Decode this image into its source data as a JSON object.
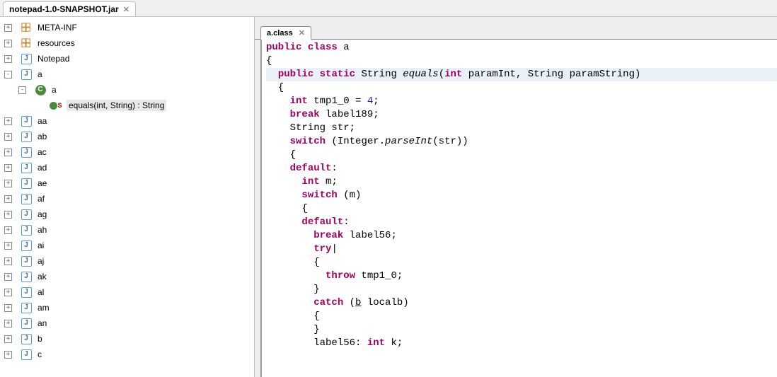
{
  "topTab": {
    "label": "notepad-1.0-SNAPSHOT.jar"
  },
  "tree": {
    "items": [
      {
        "indent": 0,
        "twisty": "+",
        "icon": "pkg",
        "label": "META-INF"
      },
      {
        "indent": 0,
        "twisty": "+",
        "icon": "pkg",
        "label": "resources"
      },
      {
        "indent": 0,
        "twisty": "+",
        "icon": "j",
        "label": "Notepad"
      },
      {
        "indent": 0,
        "twisty": "-",
        "icon": "j",
        "label": "a"
      },
      {
        "indent": 1,
        "twisty": "-",
        "icon": "c",
        "label": "a"
      },
      {
        "indent": 2,
        "twisty": "",
        "icon": "m",
        "label": "equals(int, String) : String",
        "selected": true
      },
      {
        "indent": 0,
        "twisty": "+",
        "icon": "j",
        "label": "aa"
      },
      {
        "indent": 0,
        "twisty": "+",
        "icon": "j",
        "label": "ab"
      },
      {
        "indent": 0,
        "twisty": "+",
        "icon": "j",
        "label": "ac"
      },
      {
        "indent": 0,
        "twisty": "+",
        "icon": "j",
        "label": "ad"
      },
      {
        "indent": 0,
        "twisty": "+",
        "icon": "j",
        "label": "ae"
      },
      {
        "indent": 0,
        "twisty": "+",
        "icon": "j",
        "label": "af"
      },
      {
        "indent": 0,
        "twisty": "+",
        "icon": "j",
        "label": "ag"
      },
      {
        "indent": 0,
        "twisty": "+",
        "icon": "j",
        "label": "ah"
      },
      {
        "indent": 0,
        "twisty": "+",
        "icon": "j",
        "label": "ai"
      },
      {
        "indent": 0,
        "twisty": "+",
        "icon": "j",
        "label": "aj"
      },
      {
        "indent": 0,
        "twisty": "+",
        "icon": "j",
        "label": "ak"
      },
      {
        "indent": 0,
        "twisty": "+",
        "icon": "j",
        "label": "al"
      },
      {
        "indent": 0,
        "twisty": "+",
        "icon": "j",
        "label": "am"
      },
      {
        "indent": 0,
        "twisty": "+",
        "icon": "j",
        "label": "an"
      },
      {
        "indent": 0,
        "twisty": "+",
        "icon": "j",
        "label": "b"
      },
      {
        "indent": 0,
        "twisty": "+",
        "icon": "j",
        "label": "c"
      }
    ]
  },
  "editorTab": {
    "label": "a.class"
  },
  "code": {
    "l1_kw1": "public",
    "l1_kw2": "class",
    "l1_name": "a",
    "l2": "{",
    "l3_kw1": "public",
    "l3_kw2": "static",
    "l3_type": "String",
    "l3_name": "equals",
    "l3_params_open": "(",
    "l3_p1kw": "int",
    "l3_p1": " paramInt, String paramString)",
    "l4": "  {",
    "l5_kw": "int",
    "l5_var": "tmp1_0",
    "l5_eq": " = ",
    "l5_num": "4",
    "l5_semi": ";",
    "l6_kw": "break",
    "l6_rest": " label189;",
    "l7": "    String str;",
    "l8_kw": "switch",
    "l8_open": " (Integer.",
    "l8_m": "parseInt",
    "l8_close": "(str))",
    "l9": "    {",
    "l10_kw": "default",
    "l10_rest": ":",
    "l11_kw": "int",
    "l11_rest": " m;",
    "l12_kw": "switch",
    "l12_rest": " (m)",
    "l13": "      {",
    "l14_kw": "default",
    "l14_rest": ":",
    "l15_kw": "break",
    "l15_rest": " label56;",
    "l16_kw": "try",
    "l17": "        {",
    "l18_kw": "throw",
    "l18_rest": " tmp1_0;",
    "l19": "        }",
    "l20_kw": "catch",
    "l20_open": " (",
    "l20_u": "b",
    "l20_rest": " localb)",
    "l21": "        {",
    "l22": "        }",
    "l23_lab": "        label56: ",
    "l23_kw": "int",
    "l23_rest": " k;"
  }
}
